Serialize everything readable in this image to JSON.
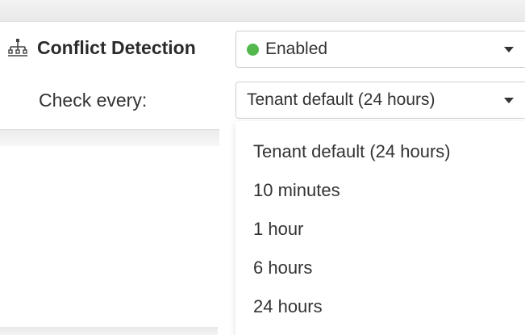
{
  "conflict_detection": {
    "label": "Conflict Detection",
    "icon": "network-tree-icon",
    "status_select": {
      "value": "Enabled",
      "status_color": "#53b84e"
    }
  },
  "check_every": {
    "label": "Check every:",
    "select": {
      "value": "Tenant default (24 hours)"
    },
    "options": [
      "Tenant default (24 hours)",
      "10 minutes",
      "1 hour",
      "6 hours",
      "24 hours"
    ]
  }
}
